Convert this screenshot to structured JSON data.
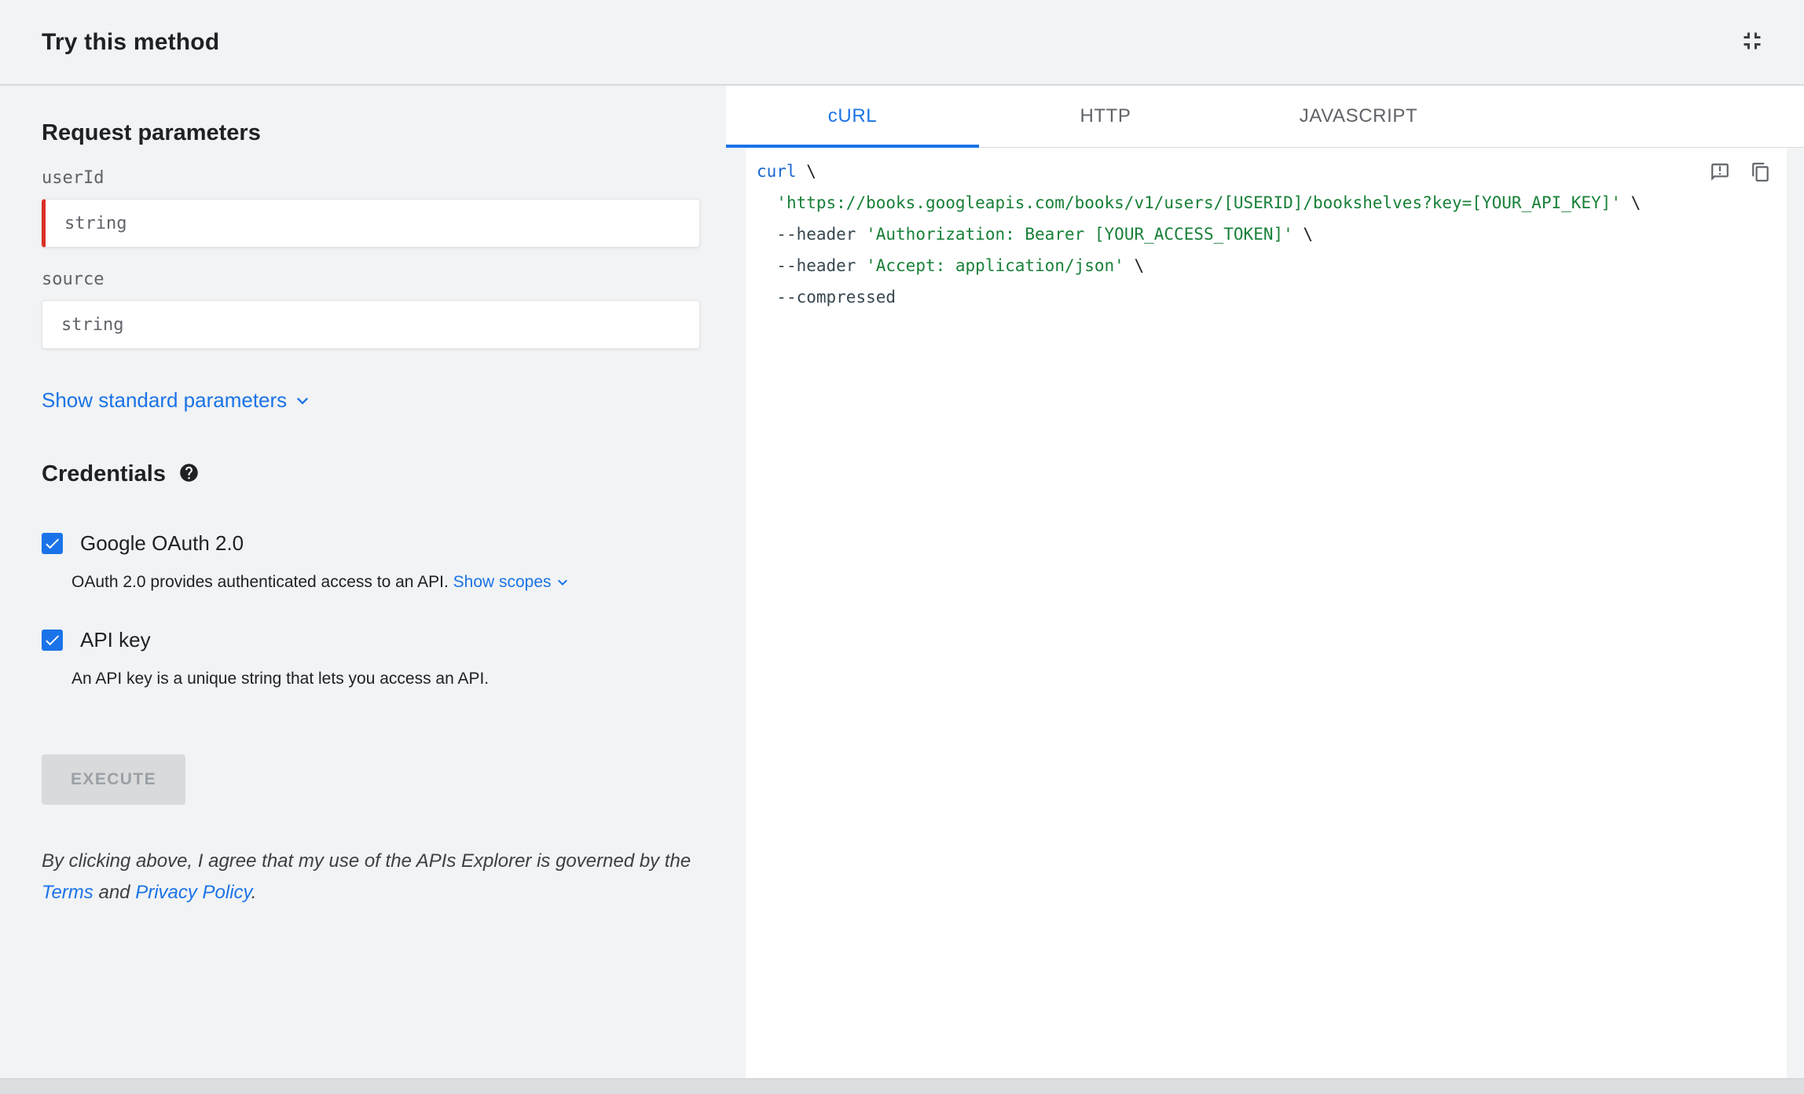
{
  "header": {
    "title": "Try this method"
  },
  "request_parameters": {
    "heading": "Request parameters",
    "fields": [
      {
        "label": "userId",
        "value": "string",
        "required": true
      },
      {
        "label": "source",
        "value": "string",
        "required": false
      }
    ],
    "show_standard_parameters_label": "Show standard parameters"
  },
  "credentials": {
    "heading": "Credentials",
    "options": [
      {
        "label": "Google OAuth 2.0",
        "checked": true,
        "description": "OAuth 2.0 provides authenticated access to an API. ",
        "link_label": "Show scopes"
      },
      {
        "label": "API key",
        "checked": true,
        "description": "An API key is a unique string that lets you access an API."
      }
    ]
  },
  "execute": {
    "label": "EXECUTE",
    "enabled": false
  },
  "disclaimer": {
    "before": "By clicking above, I agree that my use of the APIs Explorer is governed by the ",
    "terms_label": "Terms",
    "middle": " and ",
    "privacy_label": "Privacy Policy",
    "after": "."
  },
  "tabs": [
    {
      "label": "cURL",
      "active": true
    },
    {
      "label": "HTTP",
      "active": false
    },
    {
      "label": "JAVASCRIPT",
      "active": false
    }
  ],
  "code": {
    "lines": [
      [
        {
          "c": "kw",
          "t": "curl"
        },
        {
          "c": "pln",
          "t": " \\"
        }
      ],
      [
        {
          "c": "pln",
          "t": "  "
        },
        {
          "c": "str",
          "t": "'https://books.googleapis.com/books/v1/users/[USERID]/bookshelves?key=[YOUR_API_KEY]'"
        },
        {
          "c": "pln",
          "t": " \\"
        }
      ],
      [
        {
          "c": "pln",
          "t": "  "
        },
        {
          "c": "flag",
          "t": "--header"
        },
        {
          "c": "pln",
          "t": " "
        },
        {
          "c": "str",
          "t": "'Authorization: Bearer [YOUR_ACCESS_TOKEN]'"
        },
        {
          "c": "pln",
          "t": " \\"
        }
      ],
      [
        {
          "c": "pln",
          "t": "  "
        },
        {
          "c": "flag",
          "t": "--header"
        },
        {
          "c": "pln",
          "t": " "
        },
        {
          "c": "str",
          "t": "'Accept: application/json'"
        },
        {
          "c": "pln",
          "t": " \\"
        }
      ],
      [
        {
          "c": "pln",
          "t": "  "
        },
        {
          "c": "flag",
          "t": "--compressed"
        }
      ]
    ]
  },
  "icons": {
    "fullscreen_exit": "fullscreen-exit-icon",
    "help": "help-icon",
    "report": "report-issue-icon",
    "copy": "copy-icon",
    "chevron": "chevron-down-icon"
  },
  "colors": {
    "accent_blue": "#1a73e8",
    "required_red": "#d93025",
    "panel_gray": "#f1f3f4",
    "text_dark": "#202124",
    "text_gray": "#5f6368",
    "code_keyword": "#1967d2",
    "code_string": "#188038",
    "code_flag": "#37474f",
    "disabled_button_bg": "#d9dadb",
    "disabled_button_text": "#9aa0a6"
  }
}
